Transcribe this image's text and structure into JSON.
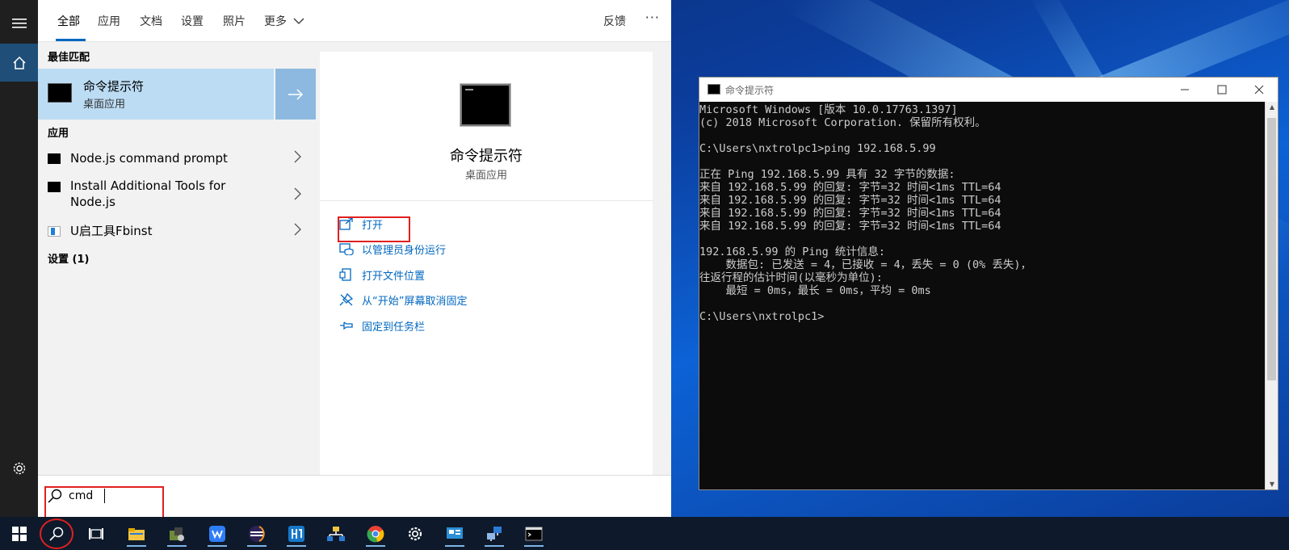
{
  "search_panel": {
    "tabs": [
      "全部",
      "应用",
      "文档",
      "设置",
      "照片",
      "更多"
    ],
    "feedback_label": "反馈",
    "more_options_label": "···",
    "best_match_header": "最佳匹配",
    "best_match": {
      "title": "命令提示符",
      "subtitle": "桌面应用"
    },
    "apps_header": "应用",
    "apps": [
      {
        "label": "Node.js command prompt"
      },
      {
        "label": "Install Additional Tools for Node.js"
      },
      {
        "label": "U启工具Fbinst"
      }
    ],
    "settings_header": "设置 (1)",
    "detail": {
      "title": "命令提示符",
      "subtitle": "桌面应用",
      "actions": [
        {
          "label": "打开",
          "icon": "open-icon"
        },
        {
          "label": "以管理员身份运行",
          "icon": "shield-icon"
        },
        {
          "label": "打开文件位置",
          "icon": "file-location-icon"
        },
        {
          "label": "从“开始”屏幕取消固定",
          "icon": "unpin-icon"
        },
        {
          "label": "固定到任务栏",
          "icon": "pin-icon"
        }
      ]
    },
    "search_query": "cmd"
  },
  "cmd_window": {
    "title": "命令提示符",
    "lines": [
      "Microsoft Windows [版本 10.0.17763.1397]",
      "(c) 2018 Microsoft Corporation. 保留所有权利。",
      "",
      "C:\\Users\\nxtrolpc1>ping 192.168.5.99",
      "",
      "正在 Ping 192.168.5.99 具有 32 字节的数据:",
      "来自 192.168.5.99 的回复: 字节=32 时间<1ms TTL=64",
      "来自 192.168.5.99 的回复: 字节=32 时间<1ms TTL=64",
      "来自 192.168.5.99 的回复: 字节=32 时间<1ms TTL=64",
      "来自 192.168.5.99 的回复: 字节=32 时间<1ms TTL=64",
      "",
      "192.168.5.99 的 Ping 统计信息:",
      "    数据包: 已发送 = 4，已接收 = 4，丢失 = 0 (0% 丢失)，",
      "往返行程的估计时间(以毫秒为单位):",
      "    最短 = 0ms，最长 = 0ms，平均 = 0ms",
      "",
      "C:\\Users\\nxtrolpc1>"
    ]
  },
  "taskbar": {
    "icons": [
      "start-icon",
      "search-icon",
      "task-view-icon",
      "file-explorer-icon",
      "app-icon",
      "wps-icon",
      "eclipse-icon",
      "app-icon",
      "network-icon",
      "chrome-icon",
      "settings-icon",
      "app-icon",
      "network-app-icon",
      "cmd-icon"
    ]
  },
  "colors": {
    "accent": "#0067c0",
    "selected": "#bcdcf4",
    "highlight": "#e02020",
    "console_bg": "#0c0c0c"
  }
}
